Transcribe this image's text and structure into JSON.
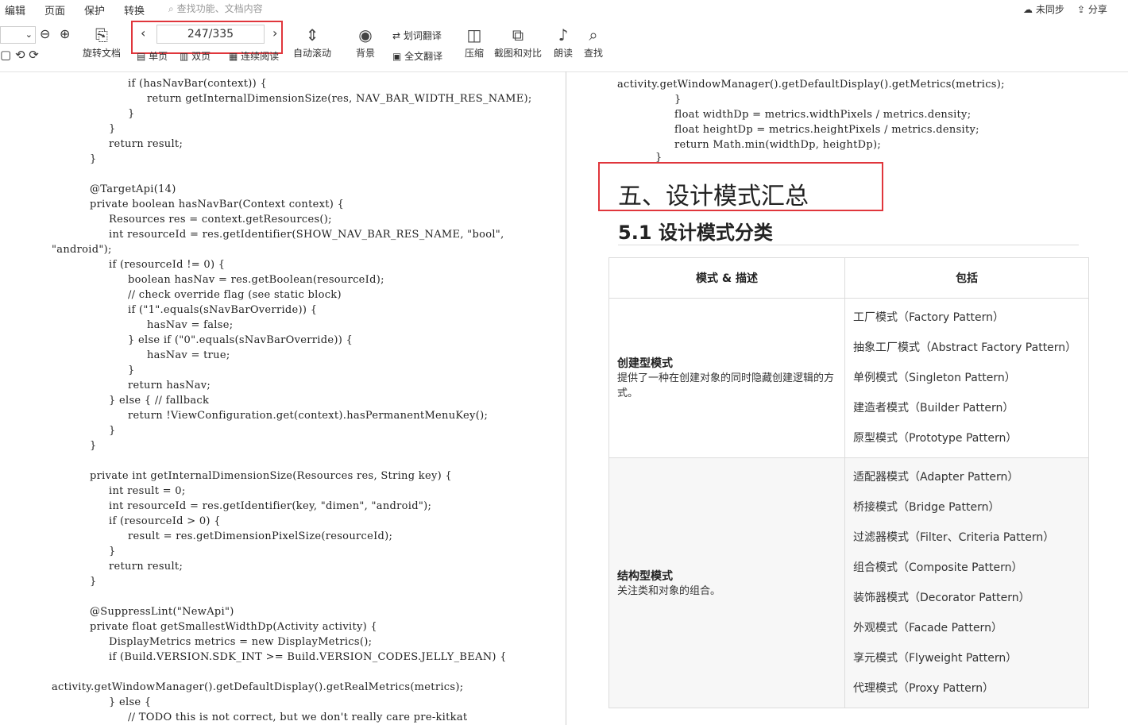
{
  "menu": [
    "编辑",
    "页面",
    "保护",
    "转换"
  ],
  "search_placeholder": "查找功能、文档内容",
  "top_right": {
    "sync": "未同步",
    "share": "分享"
  },
  "toolbar": {
    "rotate": "旋转文档",
    "single": "单页",
    "double": "双页",
    "continuous": "连续阅读",
    "auto_scroll": "自动滚动",
    "background": "背景",
    "word_translate": "划词翻译",
    "full_translate": "全文翻译",
    "compress": "压缩",
    "screenshot": "截图和对比",
    "read": "朗读",
    "find": "查找",
    "page_indicator": "247/335"
  },
  "left_code": [
    "if (hasNavBar(context)) {",
    "return getInternalDimensionSize(res, NAV_BAR_WIDTH_RES_NAME);",
    "}",
    "}",
    "return result;",
    "}",
    "@TargetApi(14)",
    "private boolean hasNavBar(Context context) {",
    "Resources res = context.getResources();",
    "int resourceId = res.getIdentifier(SHOW_NAV_BAR_RES_NAME, \"bool\",",
    "\"android\");",
    "if (resourceId != 0) {",
    "boolean hasNav = res.getBoolean(resourceId);",
    "// check override flag (see static block)",
    "if (\"1\".equals(sNavBarOverride)) {",
    "hasNav = false;",
    "} else if (\"0\".equals(sNavBarOverride)) {",
    "hasNav = true;",
    "}",
    "return hasNav;",
    "} else { // fallback",
    "return !ViewConfiguration.get(context).hasPermanentMenuKey();",
    "}",
    "}",
    "private int getInternalDimensionSize(Resources res, String key) {",
    "int result = 0;",
    "int resourceId = res.getIdentifier(key, \"dimen\", \"android\");",
    "if (resourceId > 0) {",
    "result = res.getDimensionPixelSize(resourceId);",
    "}",
    "return result;",
    "}",
    "@SuppressLint(\"NewApi\")",
    "private float getSmallestWidthDp(Activity activity) {",
    "DisplayMetrics metrics = new DisplayMetrics();",
    "if (Build.VERSION.SDK_INT >= Build.VERSION_CODES.JELLY_BEAN) {",
    "activity.getWindowManager().getDefaultDisplay().getRealMetrics(metrics);",
    "} else {",
    "// TODO this is not correct, but we don't really care pre-kitkat"
  ],
  "right_code": [
    "activity.getWindowManager().getDefaultDisplay().getMetrics(metrics);",
    "}",
    "float widthDp = metrics.widthPixels / metrics.density;",
    "float heightDp = metrics.heightPixels / metrics.density;",
    "return Math.min(widthDp, heightDp);",
    "}"
  ],
  "heading": "五、设计模式汇总",
  "subheading": "5.1  设计模式分类",
  "table": {
    "col1": "模式 & 描述",
    "col2": "包括",
    "groups": [
      {
        "title": "创建型模式",
        "desc": "提供了一种在创建对象的同时隐藏创建逻辑的方式。",
        "patterns": [
          "工厂模式（Factory Pattern）",
          "抽象工厂模式（Abstract Factory Pattern）",
          "单例模式（Singleton Pattern）",
          "建造者模式（Builder Pattern）",
          "原型模式（Prototype Pattern）"
        ]
      },
      {
        "title": "结构型模式",
        "desc": "关注类和对象的组合。",
        "patterns": [
          "适配器模式（Adapter Pattern）",
          "桥接模式（Bridge Pattern）",
          "过滤器模式（Filter、Criteria Pattern）",
          "组合模式（Composite Pattern）",
          "装饰器模式（Decorator Pattern）",
          "外观模式（Facade Pattern）",
          "享元模式（Flyweight Pattern）",
          "代理模式（Proxy Pattern）"
        ]
      }
    ]
  }
}
